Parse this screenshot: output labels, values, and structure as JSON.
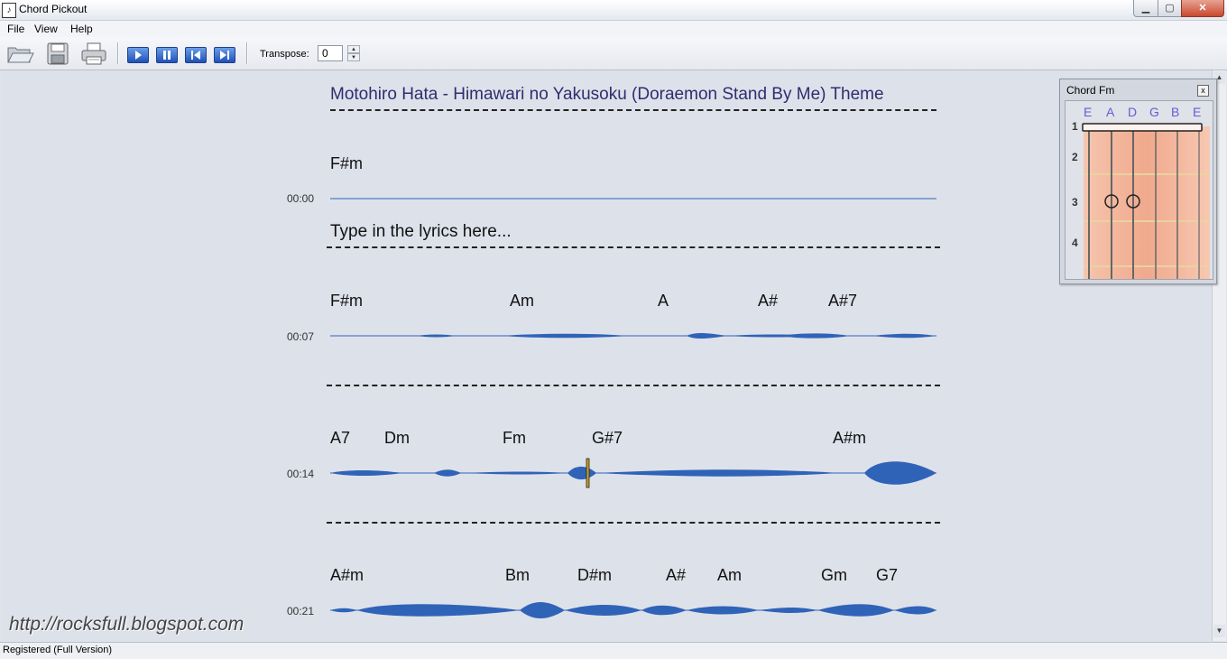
{
  "window": {
    "title": "Chord Pickout",
    "minimize": "▁",
    "maximize": "▢",
    "close": "✕"
  },
  "menu": [
    "File",
    "View",
    "Help"
  ],
  "toolbar": {
    "transpose_label": "Transpose:",
    "transpose_value": "0",
    "icons": [
      "open-folder-icon",
      "save-icon",
      "print-icon",
      "play-icon",
      "pause-icon",
      "previous-icon",
      "next-icon"
    ]
  },
  "song": {
    "title": "Motohiro Hata - Himawari no Yakusoku (Doraemon Stand By Me) Theme",
    "lyrics_placeholder": "Type in the lyrics here...",
    "rows": [
      {
        "time": "00:00",
        "chords": [
          "F#m"
        ]
      },
      {
        "time": "00:07",
        "chords": [
          "F#m",
          "Am",
          "A",
          "A#",
          "A#7"
        ]
      },
      {
        "time": "00:14",
        "chords": [
          "A7",
          "Dm",
          "Fm",
          "G#7",
          "A#m"
        ]
      },
      {
        "time": "00:21",
        "chords": [
          "A#m",
          "Bm",
          "D#m",
          "A#",
          "Am",
          "Gm",
          "G7"
        ]
      }
    ],
    "playhead_time": "00:14"
  },
  "chord_panel": {
    "title": "Chord Fm",
    "close": "x",
    "strings": [
      "E",
      "A",
      "D",
      "G",
      "B",
      "E"
    ],
    "frets": [
      "1",
      "2",
      "3",
      "4"
    ],
    "barre_fret": 1,
    "fingered_notes": [
      {
        "string": 2,
        "fret": 3
      },
      {
        "string": 3,
        "fret": 3
      }
    ]
  },
  "watermark": "http://rocksfull.blogspot.com",
  "status": "Registered (Full Version)",
  "colors": {
    "waveform": "#2f63b8",
    "title_text": "#2e2e6e",
    "string_label": "#6a5ad3",
    "fretboard": "#f2b59f"
  }
}
